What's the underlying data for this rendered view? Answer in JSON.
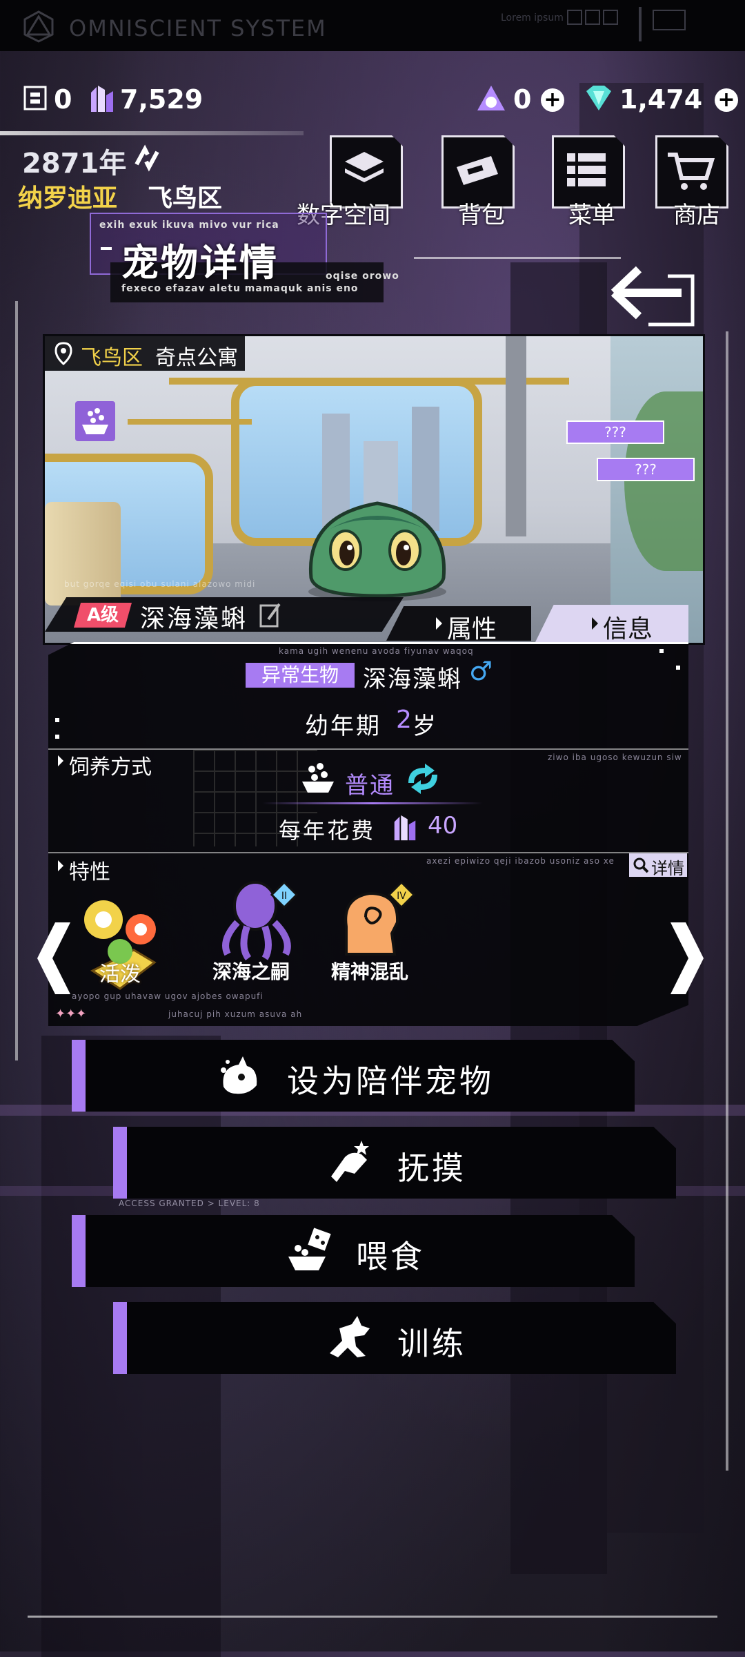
{
  "system": {
    "title": "OMNISCIENT SYSTEM",
    "lorem": "Lorem ipsum"
  },
  "resources": {
    "chips": "0",
    "crystals": "7,529",
    "tokens": "0",
    "gems": "1,474"
  },
  "location": {
    "year": "2871年",
    "city": "纳罗迪亚",
    "district": "飞鸟区"
  },
  "nav": {
    "digital_space": "数字空间",
    "backpack": "背包",
    "menu": "菜单",
    "shop": "商店"
  },
  "header": {
    "title": "宠物详情",
    "code_top": "exih exuk ikuva mivo vur rica",
    "code_bottom": "fexeco efazav aletu mamaquk anis eno",
    "code_right": "oqise orowo"
  },
  "scene": {
    "district": "飞鸟区",
    "place": "奇点公寓",
    "tag1": "???",
    "tag2": "???",
    "faint_code": "but gorqe eqisi obu sulani alazowo midi",
    "rank": "A级",
    "pet_name": "深海藻蝌"
  },
  "tabs": {
    "attributes": "属性",
    "info": "信息"
  },
  "info": {
    "code_top": "kama ugih wenenu avoda fiyunav waqoq",
    "species_tag": "异常生物",
    "species_name": "深海藻蝌",
    "gender_symbol": "♂",
    "stage": "幼年期",
    "age_num": "2",
    "age_unit": "岁"
  },
  "feeding": {
    "label": "饲养方式",
    "code": "ziwo iba ugoso kewuzun siw",
    "mode": "普通",
    "cost_label": "每年花费",
    "cost_value": "40"
  },
  "traits": {
    "label": "特性",
    "code": "axezi epiwizo qeji ibazob usoniz aso xe",
    "detail": "详情",
    "items": [
      {
        "name": "活泼",
        "badge": ""
      },
      {
        "name": "深海之嗣",
        "badge": "II"
      },
      {
        "name": "精神混乱",
        "badge": "IV"
      }
    ],
    "footer_code_1": "ayopo gup uhavaw ugov ajobes owapufi",
    "footer_code_2": "juhacuj pih xuzum asuva ah"
  },
  "actions": {
    "companion": "设为陪伴宠物",
    "pet": "抚摸",
    "feed": "喂食",
    "train": "训练",
    "access_code": "ACCESS GRANTED > LEVEL: 8"
  },
  "colors": {
    "accent": "#a77bf2",
    "gold": "#f2d24a",
    "cyan": "#3fd0e0"
  }
}
